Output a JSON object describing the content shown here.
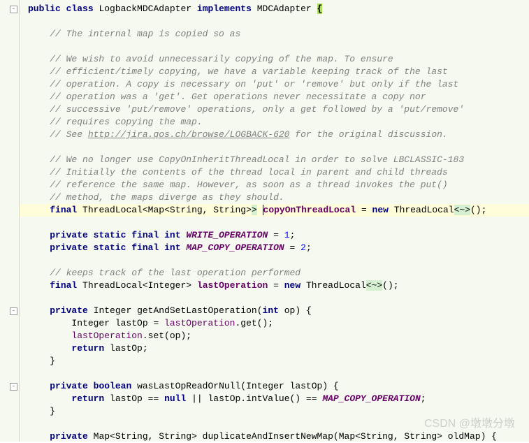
{
  "code": {
    "l1a": "public",
    "l1b": "class",
    "l1c": "LogbackMDCAdapter",
    "l1d": "implements",
    "l1e": "MDCAdapter",
    "c1": "// The internal map is copied so as",
    "c2": "// We wish to avoid unnecessarily copying of the map. To ensure",
    "c3": "// efficient/timely copying, we have a variable keeping track of the last",
    "c4": "// operation. A copy is necessary on 'put' or 'remove' but only if the last",
    "c5": "// operation was a 'get'. Get operations never necessitate a copy nor",
    "c6": "// successive 'put/remove' operations, only a get followed by a 'put/remove'",
    "c7": "// requires copying the map.",
    "c8a": "// See ",
    "c8link": "http://jira.qos.ch/browse/LOGBACK-620",
    "c8b": " for the original discussion.",
    "c9": "// We no longer use CopyOnInheritThreadLocal in order to solve LBCLASSIC-183",
    "c10": "// Initially the contents of the thread local in parent and child threads",
    "c11": "// reference the same map. However, as soon as a thread invokes the put()",
    "c12": "// method, the maps diverge as they should.",
    "f1a": "final",
    "f1b": "ThreadLocal<Map<String, String>",
    "f1c": ">",
    "f1d": "copyOnThreadLocal",
    "f1e": "new",
    "f1f": "ThreadLocal",
    "f1g": "<~>",
    "f1h": "();",
    "f2a": "private",
    "f2b": "static",
    "f2c": "final",
    "f2d": "int",
    "f2e": "WRITE_OPERATION",
    "f2f": "1",
    "f3e": "MAP_COPY_OPERATION",
    "f3f": "2",
    "c13": "// keeps track of the last operation performed",
    "f4b": "ThreadLocal<Integer>",
    "f4d": "lastOperation",
    "m1a": "private",
    "m1b": "Integer",
    "m1c": "getAndSetLastOperation",
    "m1d": "int",
    "m1e": "op",
    "m1l1": "Integer lastOp = ",
    "m1l1b": "lastOperation",
    "m1l1c": ".get();",
    "m1l2a": "lastOperation",
    "m1l2b": ".set(op);",
    "m1l3a": "return",
    "m1l3b": " lastOp;",
    "m2a": "private",
    "m2b": "boolean",
    "m2c": "wasLastOpReadOrNull",
    "m2d": "Integer lastOp",
    "m2l1a": "return",
    "m2l1b": " lastOp == ",
    "m2l1c": "null",
    "m2l1d": " || lastOp.intValue() == ",
    "m2l1e": "MAP_COPY_OPERATION",
    "m3a": "private",
    "m3b": "Map<String, String> ",
    "m3c": "duplicateAndInsertNewMap",
    "m3d": "Map<String, String> oldMap"
  },
  "watermark": "CSDN @墩墩分墩"
}
